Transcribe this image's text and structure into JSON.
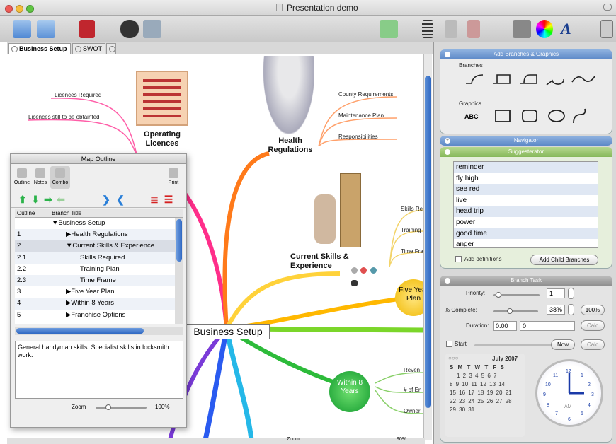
{
  "window": {
    "title": "Presentation demo"
  },
  "tabs": [
    {
      "label": "Business Setup"
    },
    {
      "label": "SWOT"
    }
  ],
  "map": {
    "central": "Business Setup",
    "topics": {
      "operating_licences": "Operating Licences",
      "health_regulations": "Health Regulations",
      "current_skills": "Current Skills & Experience",
      "five_year_plan": "Five Year Plan",
      "within_8_years": "Within 8 Years"
    },
    "branches": {
      "licences_required": "Licences Required",
      "licences_to_obtain": "Licences still to be obtainted",
      "county_requirements": "County Requirements",
      "maintenance_plan": "Maintenance Plan",
      "responsibilities": "Responsibilities",
      "skills_required": "Skills Re",
      "training": "Training",
      "time_frame": "Time Fra",
      "revenue": "Reven",
      "num_employees": "# of En",
      "owner": "Owner"
    },
    "zoom_label": "Zoom",
    "zoom_value": "90%"
  },
  "panel": {
    "add_branches": {
      "title": "Add Branches & Graphics",
      "branches_label": "Branches",
      "graphics_label": "Graphics",
      "abc": "ABC"
    },
    "navigator": {
      "title": "Navigator"
    },
    "suggesterator": {
      "title": "Suggesterator",
      "words": [
        "reminder",
        "fly high",
        "see red",
        "live",
        "head trip",
        "power",
        "good time",
        "anger"
      ],
      "add_definitions": "Add definitions",
      "add_child": "Add Child Branches"
    },
    "branch_task": {
      "title": "Branch Task",
      "priority_label": "Priority:",
      "priority_value": "1",
      "complete_label": "% Complete:",
      "complete_value": "38%",
      "complete_fraction": 0.38,
      "pct100": "100%",
      "duration_label": "Duration:",
      "duration_value": "0.00",
      "duration_unit": "0",
      "calc": "Calc",
      "start_label": "Start",
      "now": "Now",
      "calendar": {
        "month": "July 2007",
        "days_header": "S M T W T F S",
        "weeks": [
          "1 2 3 4 5 6 7",
          "8 9 10 11 12 13 14",
          "15 16 17 18 19 20 21",
          "22 23 24 25 26 27 28",
          "29 30 31"
        ]
      },
      "clock": {
        "am": "AM",
        "numbers": [
          "12",
          "1",
          "2",
          "3",
          "4",
          "5",
          "6",
          "7",
          "8",
          "9",
          "10",
          "11"
        ]
      }
    }
  },
  "outline": {
    "title": "Map Outline",
    "tabs": [
      "Outline",
      "Notes",
      "Combo"
    ],
    "print": "Print",
    "col_outline": "Outline",
    "col_title": "Branch Title",
    "rows": [
      {
        "num": "",
        "title": "▼Business Setup",
        "indent": 1
      },
      {
        "num": "1",
        "title": "▶Health Regulations",
        "indent": 2
      },
      {
        "num": "2",
        "title": "▼Current Skills & Experience",
        "indent": 2
      },
      {
        "num": "2.1",
        "title": "Skills Required",
        "indent": 3
      },
      {
        "num": "2.2",
        "title": "Training Plan",
        "indent": 3
      },
      {
        "num": "2.3",
        "title": "Time Frame",
        "indent": 3
      },
      {
        "num": "3",
        "title": "▶Five Year Plan",
        "indent": 2
      },
      {
        "num": "4",
        "title": "▶Within 8 Years",
        "indent": 2
      },
      {
        "num": "5",
        "title": "▶Franchise Options",
        "indent": 2
      }
    ],
    "notes_text": "General handyman skills. Specialist skills in locksmith work.",
    "zoom_label": "Zoom",
    "zoom_value": "100%"
  }
}
